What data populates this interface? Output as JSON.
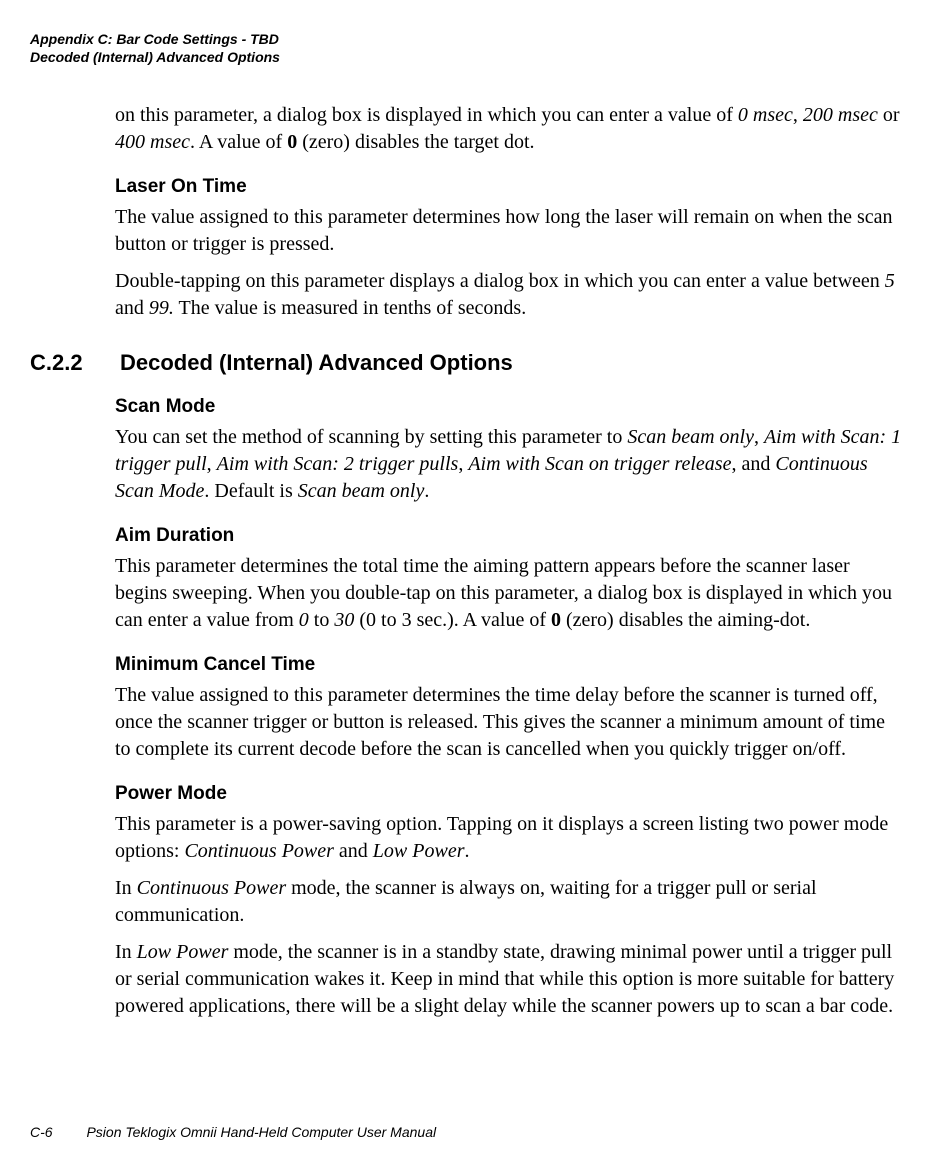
{
  "header": {
    "line1": "Appendix C: Bar Code Settings - TBD",
    "line2": "Decoded (Internal) Advanced Options"
  },
  "intro": {
    "p1_a": "on this parameter, a dialog box is displayed in which you can enter a value of ",
    "p1_v1": "0 msec",
    "p1_b": ", ",
    "p1_v2": "200 msec",
    "p1_c": " or ",
    "p1_v3": "400 msec",
    "p1_d": ". A value of ",
    "p1_zero": "0",
    "p1_e": " (zero) disables the target dot."
  },
  "laserOnTime": {
    "h": "Laser On Time",
    "p1": "The value assigned to this parameter determines how long the laser will remain on when the scan button or trigger is pressed.",
    "p2_a": "Double-tapping on this parameter displays a dialog box in which you can enter a value between ",
    "p2_v1": "5",
    "p2_b": " and ",
    "p2_v2": "99.",
    "p2_c": " The value is measured in tenths of seconds."
  },
  "sectionC22": {
    "num": "C.2.2",
    "title": "Decoded (Internal) Advanced Options"
  },
  "scanMode": {
    "h": " Scan Mode",
    "p_a": "You can set the method of scanning by setting this parameter to ",
    "v1": "Scan beam only",
    "c1": ", ",
    "v2": "Aim with Scan: 1 trigger pull",
    "c2": ", ",
    "v3": "Aim with Scan: 2 trigger pulls",
    "c3": ", ",
    "v4": "Aim with Scan on trigger release",
    "c4": ", and ",
    "v5": "Continuous Scan Mode",
    "p_b": ". Default is ",
    "v6": "Scan beam only",
    "p_c": "."
  },
  "aimDuration": {
    "h": "Aim Duration",
    "p_a": "This parameter determines the total time the aiming pattern appears before the scanner laser begins sweeping. When you double-tap on this parameter, a dialog box is displayed in which you can enter a value from ",
    "v1": "0",
    "p_b": " to ",
    "v2": "30",
    "p_c": " (0 to 3 sec.). A value of ",
    "zero": "0",
    "p_d": " (zero) disables the aiming-dot."
  },
  "minCancel": {
    "h": "Minimum Cancel Time",
    "p": "The value assigned to this parameter determines the time delay before the scanner is turned off, once the scanner trigger or button is released. This gives the scanner a minimum amount of time to complete its current decode before the scan is cancelled when you quickly trigger on/off."
  },
  "powerMode": {
    "h": "Power Mode",
    "p1_a": "This parameter is a power-saving option. Tapping on it displays a screen listing two power mode options: ",
    "v1": "Continuous Power",
    "p1_b": " and ",
    "v2": "Low Power",
    "p1_c": ".",
    "p2_a": "In ",
    "p2_v": "Continuous Power",
    "p2_b": " mode, the scanner is always on, waiting for a trigger pull or serial communication.",
    "p3_a": "In ",
    "p3_v": "Low Power",
    "p3_b": " mode, the scanner is in a standby state, drawing minimal power until a trigger pull or serial communication wakes it. Keep in mind that while this option is more suitable for battery powered applications, there will be a slight delay while the scanner powers up to scan a bar code."
  },
  "footer": {
    "page": "C-6",
    "title": "Psion Teklogix Omnii Hand-Held Computer User Manual"
  }
}
